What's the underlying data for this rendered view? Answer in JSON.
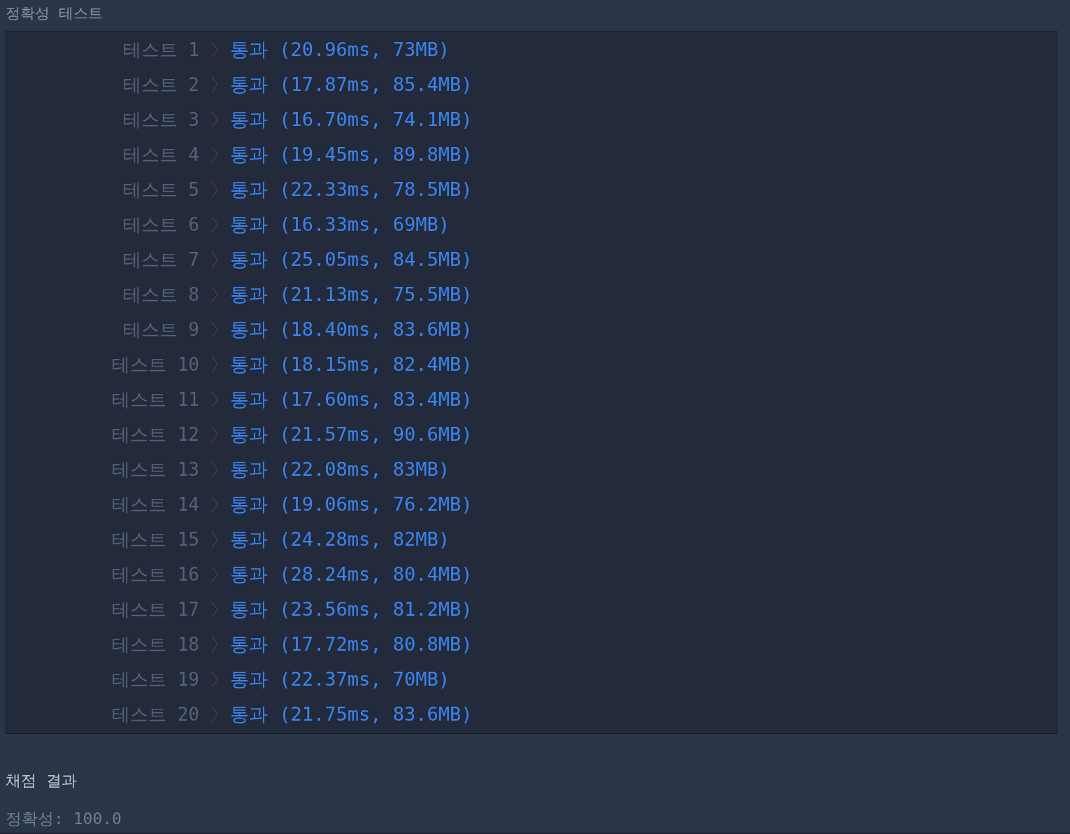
{
  "heading": "정확성  테스트",
  "tests": [
    {
      "label": "테스트 1",
      "result": "통과 (20.96ms, 73MB)"
    },
    {
      "label": "테스트 2",
      "result": "통과 (17.87ms, 85.4MB)"
    },
    {
      "label": "테스트 3",
      "result": "통과 (16.70ms, 74.1MB)"
    },
    {
      "label": "테스트 4",
      "result": "통과 (19.45ms, 89.8MB)"
    },
    {
      "label": "테스트 5",
      "result": "통과 (22.33ms, 78.5MB)"
    },
    {
      "label": "테스트 6",
      "result": "통과 (16.33ms, 69MB)"
    },
    {
      "label": "테스트 7",
      "result": "통과 (25.05ms, 84.5MB)"
    },
    {
      "label": "테스트 8",
      "result": "통과 (21.13ms, 75.5MB)"
    },
    {
      "label": "테스트 9",
      "result": "통과 (18.40ms, 83.6MB)"
    },
    {
      "label": "테스트 10",
      "result": "통과 (18.15ms, 82.4MB)"
    },
    {
      "label": "테스트 11",
      "result": "통과 (17.60ms, 83.4MB)"
    },
    {
      "label": "테스트 12",
      "result": "통과 (21.57ms, 90.6MB)"
    },
    {
      "label": "테스트 13",
      "result": "통과 (22.08ms, 83MB)"
    },
    {
      "label": "테스트 14",
      "result": "통과 (19.06ms, 76.2MB)"
    },
    {
      "label": "테스트 15",
      "result": "통과 (24.28ms, 82MB)"
    },
    {
      "label": "테스트 16",
      "result": "통과 (28.24ms, 80.4MB)"
    },
    {
      "label": "테스트 17",
      "result": "통과 (23.56ms, 81.2MB)"
    },
    {
      "label": "테스트 18",
      "result": "통과 (17.72ms, 80.8MB)"
    },
    {
      "label": "테스트 19",
      "result": "통과 (22.37ms, 70MB)"
    },
    {
      "label": "테스트 20",
      "result": "통과 (21.75ms, 83.6MB)"
    }
  ],
  "summary": {
    "title": "채점  결과",
    "score": "정확성: 100.0"
  }
}
